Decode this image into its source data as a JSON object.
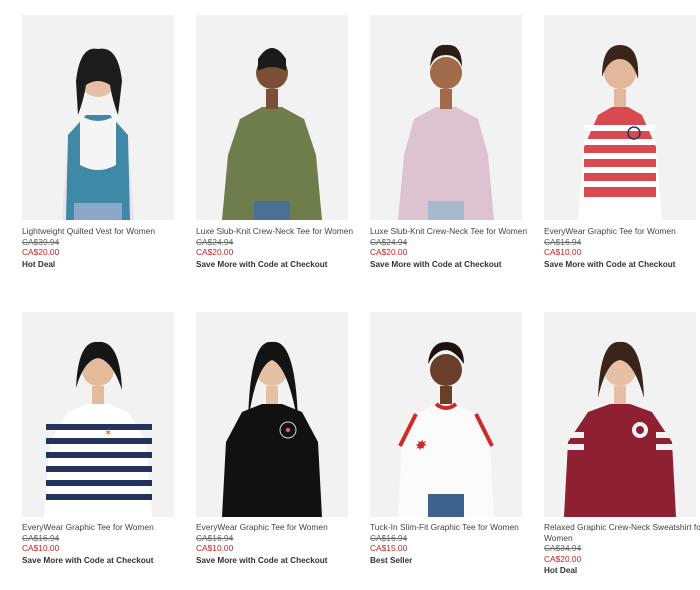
{
  "products": [
    {
      "name": "Lightweight Quilted Vest for Women",
      "old_price": "CA$39.94",
      "price": "CA$20.00",
      "badge": "Hot Deal",
      "palette": {
        "bg": "#f2f2f2",
        "top": "#3f89a6",
        "accent": "#e8e3ec",
        "pants": "#8aa7c8",
        "hair": "#1c1c1c",
        "skin": "#e6c0a4"
      }
    },
    {
      "name": "Luxe Slub-Knit Crew-Neck Tee for Women",
      "old_price": "CA$24.94",
      "price": "CA$20.00",
      "badge": "Save More with Code at Checkout",
      "palette": {
        "bg": "#f2f2f2",
        "top": "#6f7d4d",
        "accent": "#6f7d4d",
        "pants": "#4b6f97",
        "hair": "#1a1a1a",
        "skin": "#7a4f36"
      }
    },
    {
      "name": "Luxe Slub-Knit Crew-Neck Tee for Women",
      "old_price": "CA$24.94",
      "price": "CA$20.00",
      "badge": "Save More with Code at Checkout",
      "palette": {
        "bg": "#f2f2f2",
        "top": "#dcc3cf",
        "accent": "#dcc3cf",
        "pants": "#a7b9cc",
        "hair": "#2a1d16",
        "skin": "#a06a4b"
      }
    },
    {
      "name": "EveryWear Graphic Tee for Women",
      "old_price": "CA$16.94",
      "price": "CA$10.00",
      "badge": "Save More with Code at Checkout",
      "palette": {
        "bg": "#f2f2f2",
        "top": "#d84a4f",
        "accent": "#ffffff",
        "pants": "#ffffff",
        "hair": "#3a2518",
        "skin": "#e3b79b"
      }
    },
    {
      "name": "EveryWear Graphic Tee for Women",
      "old_price": "CA$16.94",
      "price": "CA$10.00",
      "badge": "Save More with Code at Checkout",
      "palette": {
        "bg": "#f2f2f2",
        "top": "#22345e",
        "accent": "#ffffff",
        "pants": "#4b6f97",
        "hair": "#161616",
        "skin": "#e2bb9c"
      }
    },
    {
      "name": "EveryWear Graphic Tee for Women",
      "old_price": "CA$16.94",
      "price": "CA$10.00",
      "badge": "Save More with Code at Checkout",
      "palette": {
        "bg": "#f2f2f2",
        "top": "#111111",
        "accent": "#111111",
        "pants": "#4b6f97",
        "hair": "#141414",
        "skin": "#e4c0a4"
      }
    },
    {
      "name": "Tuck-In Slim-Fit Graphic Tee for Women",
      "old_price": "CA$16.94",
      "price": "CA$15.00",
      "badge": "Best Seller",
      "palette": {
        "bg": "#f2f2f2",
        "top": "#fbfbfb",
        "accent": "#cf2a2a",
        "pants": "#3d628e",
        "hair": "#1b120e",
        "skin": "#6a3f29"
      }
    },
    {
      "name": "Relaxed Graphic Crew-Neck Sweatshirt for Women",
      "old_price": "CA$34.94",
      "price": "CA$20.00",
      "badge": "Hot Deal",
      "palette": {
        "bg": "#f2f2f2",
        "top": "#8f1f33",
        "accent": "#f2f2f2",
        "pants": "#3f5f8b",
        "hair": "#3a2318",
        "skin": "#e5c0a4"
      }
    }
  ]
}
